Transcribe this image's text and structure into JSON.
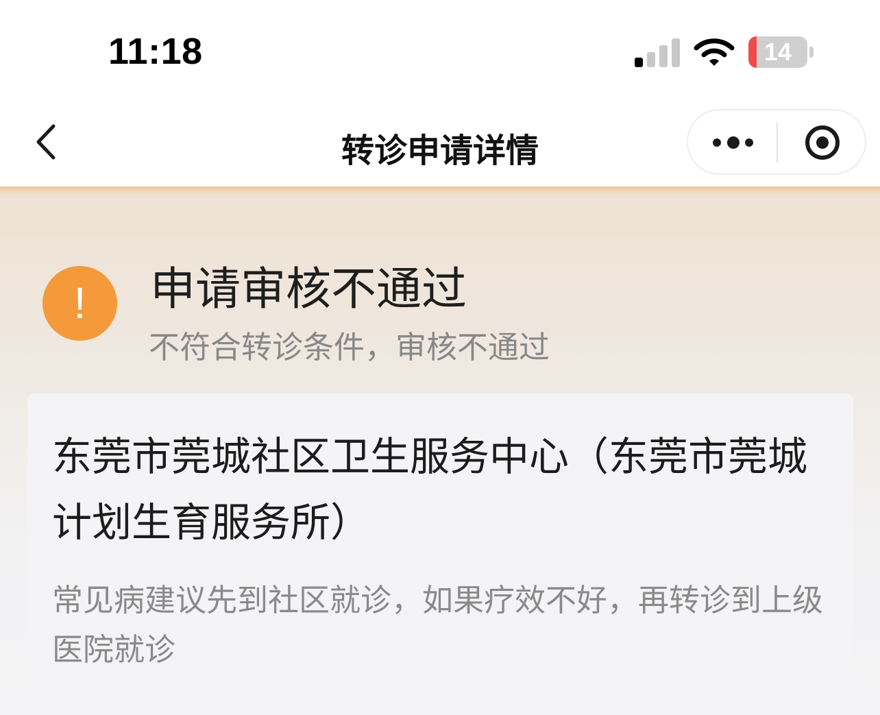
{
  "status_bar": {
    "time": "11:18",
    "battery_level": "14",
    "battery_fraction": 0.14,
    "signal_bars_active": 1,
    "signal_bars_total": 4,
    "battery_color": "#f04b4b"
  },
  "nav": {
    "title": "转诊申请详情",
    "back_icon": "chevron-left-icon",
    "more_icon": "more-dots-icon",
    "close_icon": "target-close-icon"
  },
  "review_status": {
    "icon": "exclamation-icon",
    "icon_color": "#f59a3b",
    "icon_glyph": "!",
    "title": "申请审核不通过",
    "reason": "不符合转诊条件，审核不通过"
  },
  "hospital": {
    "name": "东莞市莞城社区卫生服务中心（东莞市莞城计划生育服务所）",
    "advice": "常见病建议先到社区就诊，如果疗效不好，再转诊到上级医院就诊"
  }
}
